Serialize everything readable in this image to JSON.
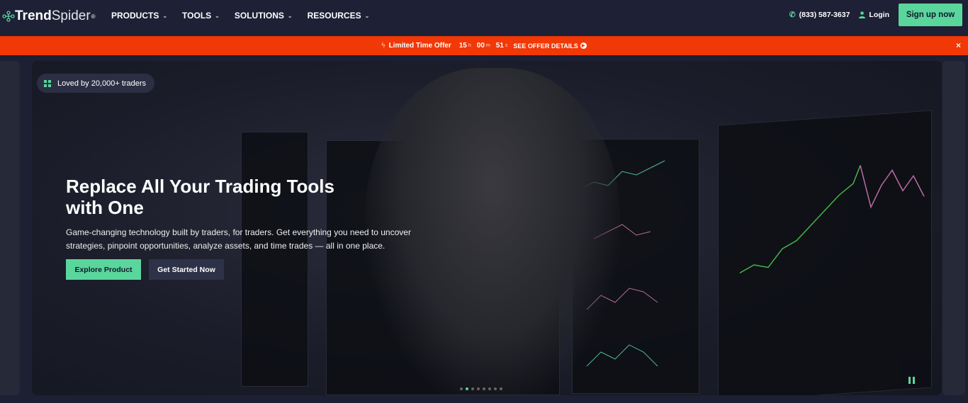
{
  "nav": {
    "brand_bold": "Trend",
    "brand_light": "Spider",
    "brand_mark": "®",
    "menu": [
      {
        "label": "PRODUCTS"
      },
      {
        "label": "TOOLS"
      },
      {
        "label": "SOLUTIONS"
      },
      {
        "label": "RESOURCES"
      }
    ],
    "phone": "(833) 587-3637",
    "login": "Login",
    "signup": "Sign up now"
  },
  "offer": {
    "label": "Limited Time Offer",
    "hours": "15",
    "h": "h",
    "minutes": "00",
    "m": "m",
    "seconds": "51",
    "s": "s",
    "details": "SEE OFFER DETAILS",
    "close": "×"
  },
  "hero": {
    "badge": "Loved by 20,000+ traders",
    "title": "Replace All Your Trading Tools with One",
    "subtitle": "Game-changing technology built by traders, for traders. Get everything you need to uncover strategies, pinpoint opportunities, analyze assets, and time trades — all in one place.",
    "explore": "Explore Product",
    "started": "Get Started Now"
  },
  "colors": {
    "accent": "#5ad69d",
    "offer": "#f23806",
    "nav": "#1e2035"
  }
}
